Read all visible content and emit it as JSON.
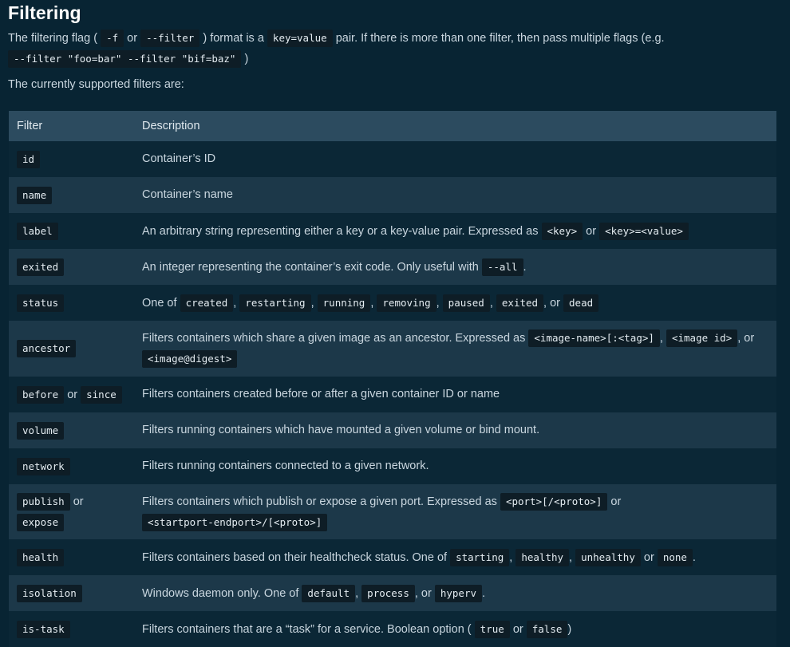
{
  "section": {
    "title": "Filtering"
  },
  "intro": {
    "t1": "The filtering flag (",
    "c1": "-f",
    "t2": "or",
    "c2": "--filter",
    "t3": ") format is a",
    "c3": "key=value",
    "t4": "pair. If there is more than one filter, then pass multiple flags (e.g.",
    "c4": "--filter \"foo=bar\" --filter \"bif=baz\"",
    "t5": ")",
    "supported": "The currently supported filters are:"
  },
  "table": {
    "headers": [
      "Filter",
      "Description"
    ],
    "rows": [
      {
        "filter": [
          "id"
        ],
        "desc": [
          "Container’s ID"
        ]
      },
      {
        "filter": [
          "name"
        ],
        "desc": [
          "Container’s name"
        ]
      },
      {
        "filter": [
          "label"
        ],
        "desc": [
          "An arbitrary string representing either a key or a key-value pair. Expressed as",
          "<key>",
          "or",
          "<key>=<value>"
        ]
      },
      {
        "filter": [
          "exited"
        ],
        "desc": [
          "An integer representing the container’s exit code. Only useful with",
          "--all",
          "."
        ]
      },
      {
        "filter": [
          "status"
        ],
        "desc": [
          "One of",
          "created",
          ",",
          "restarting",
          ",",
          "running",
          ",",
          "removing",
          ",",
          "paused",
          ",",
          "exited",
          ", or",
          "dead"
        ]
      },
      {
        "filter": [
          "ancestor"
        ],
        "desc": [
          "Filters containers which share a given image as an ancestor. Expressed as",
          "<image-name>[:<tag>]",
          ",",
          "<image id>",
          ", or",
          "<image@digest>"
        ]
      },
      {
        "filter": [
          "before",
          "or",
          "since"
        ],
        "desc": [
          "Filters containers created before or after a given container ID or name"
        ]
      },
      {
        "filter": [
          "volume"
        ],
        "desc": [
          "Filters running containers which have mounted a given volume or bind mount."
        ]
      },
      {
        "filter": [
          "network"
        ],
        "desc": [
          "Filters running containers connected to a given network."
        ]
      },
      {
        "filter": [
          "publish",
          "or",
          "expose"
        ],
        "desc": [
          "Filters containers which publish or expose a given port. Expressed as",
          "<port>[/<proto>]",
          "or",
          "<startport-endport>/[<proto>]"
        ]
      },
      {
        "filter": [
          "health"
        ],
        "desc": [
          "Filters containers based on their healthcheck status. One of",
          "starting",
          ",",
          "healthy",
          ",",
          "unhealthy",
          "or",
          "none",
          "."
        ]
      },
      {
        "filter": [
          "isolation"
        ],
        "desc": [
          "Windows daemon only. One of",
          "default",
          ",",
          "process",
          ", or",
          "hyperv",
          "."
        ]
      },
      {
        "filter": [
          "is-task"
        ],
        "desc": [
          "Filters containers that are a “task” for a service. Boolean option (",
          "true",
          "or",
          "false",
          ")"
        ]
      }
    ]
  }
}
